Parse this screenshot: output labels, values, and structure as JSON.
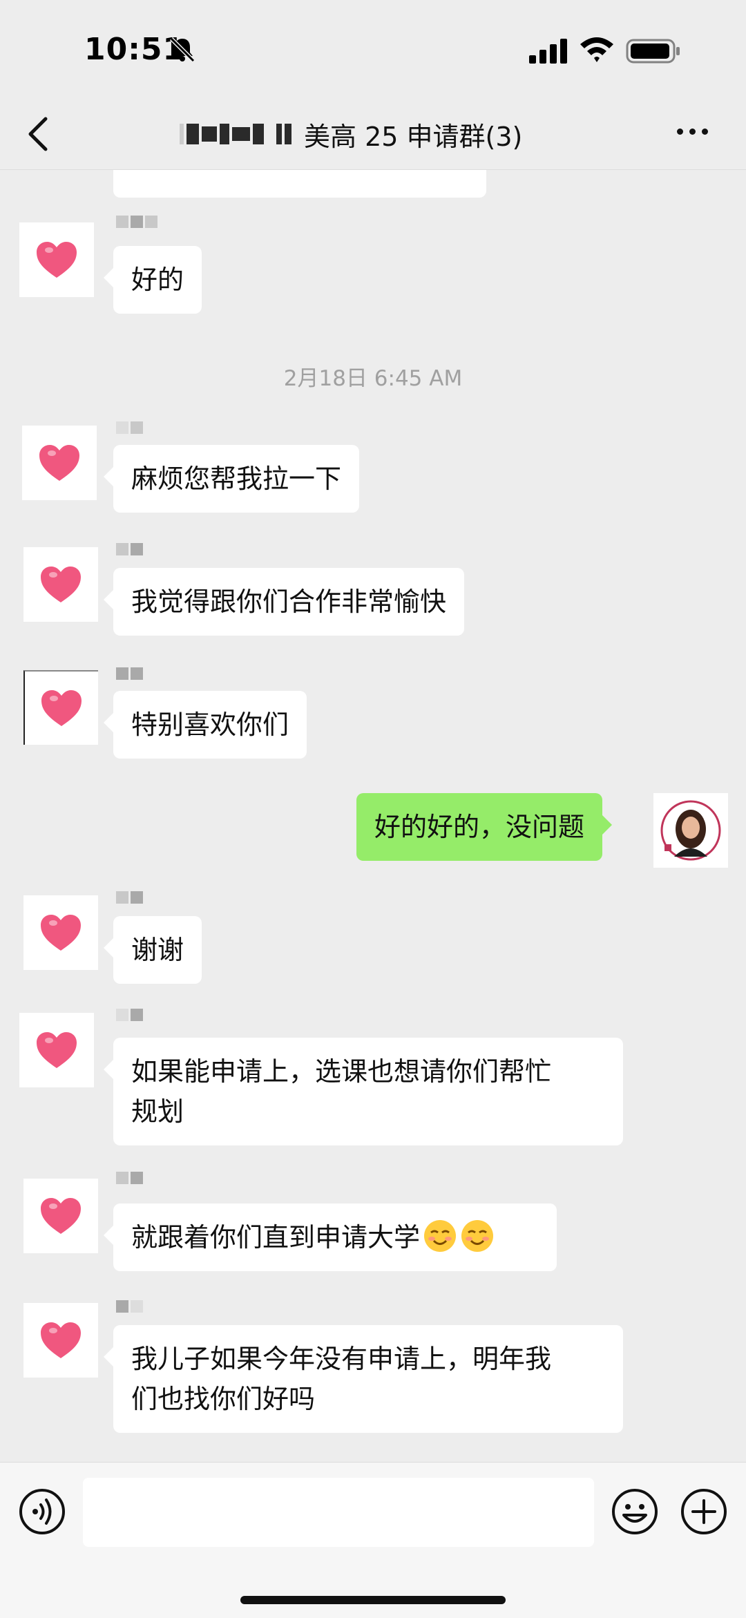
{
  "status_bar": {
    "time": "10:51"
  },
  "header": {
    "title": "美高 25 申请群(3)"
  },
  "colors": {
    "background": "#ededed",
    "my_bubble": "#95ec69",
    "their_bubble": "#ffffff",
    "heart": "#f0577f"
  },
  "messages": {
    "m0": {
      "text": "好的",
      "side": "left"
    },
    "t1": {
      "text": "2月18日 6:45 AM"
    },
    "m1": {
      "text": "麻烦您帮我拉一下",
      "side": "left"
    },
    "m2": {
      "text": "我觉得跟你们合作非常愉快",
      "side": "left"
    },
    "m3": {
      "text": "特别喜欢你们",
      "side": "left"
    },
    "m4": {
      "text": "好的好的，没问题",
      "side": "right"
    },
    "m5": {
      "text": "谢谢",
      "side": "left"
    },
    "m6": {
      "line1": "如果能申请上，选课也想请你们帮忙",
      "line2": "规划",
      "side": "left"
    },
    "m7": {
      "text": "就跟着你们直到申请大学",
      "emoji": "smiling-face-icon x2",
      "side": "left"
    },
    "m8": {
      "line1": "我儿子如果今年没有申请上，明年我",
      "line2": "们也找你们好吗",
      "side": "left"
    }
  },
  "icons": {
    "back": "chevron-left-icon",
    "more": "more-dots-icon",
    "voice": "voice-icon",
    "emoji": "emoji-icon",
    "plus": "plus-icon",
    "avatar": "heart-icon"
  }
}
